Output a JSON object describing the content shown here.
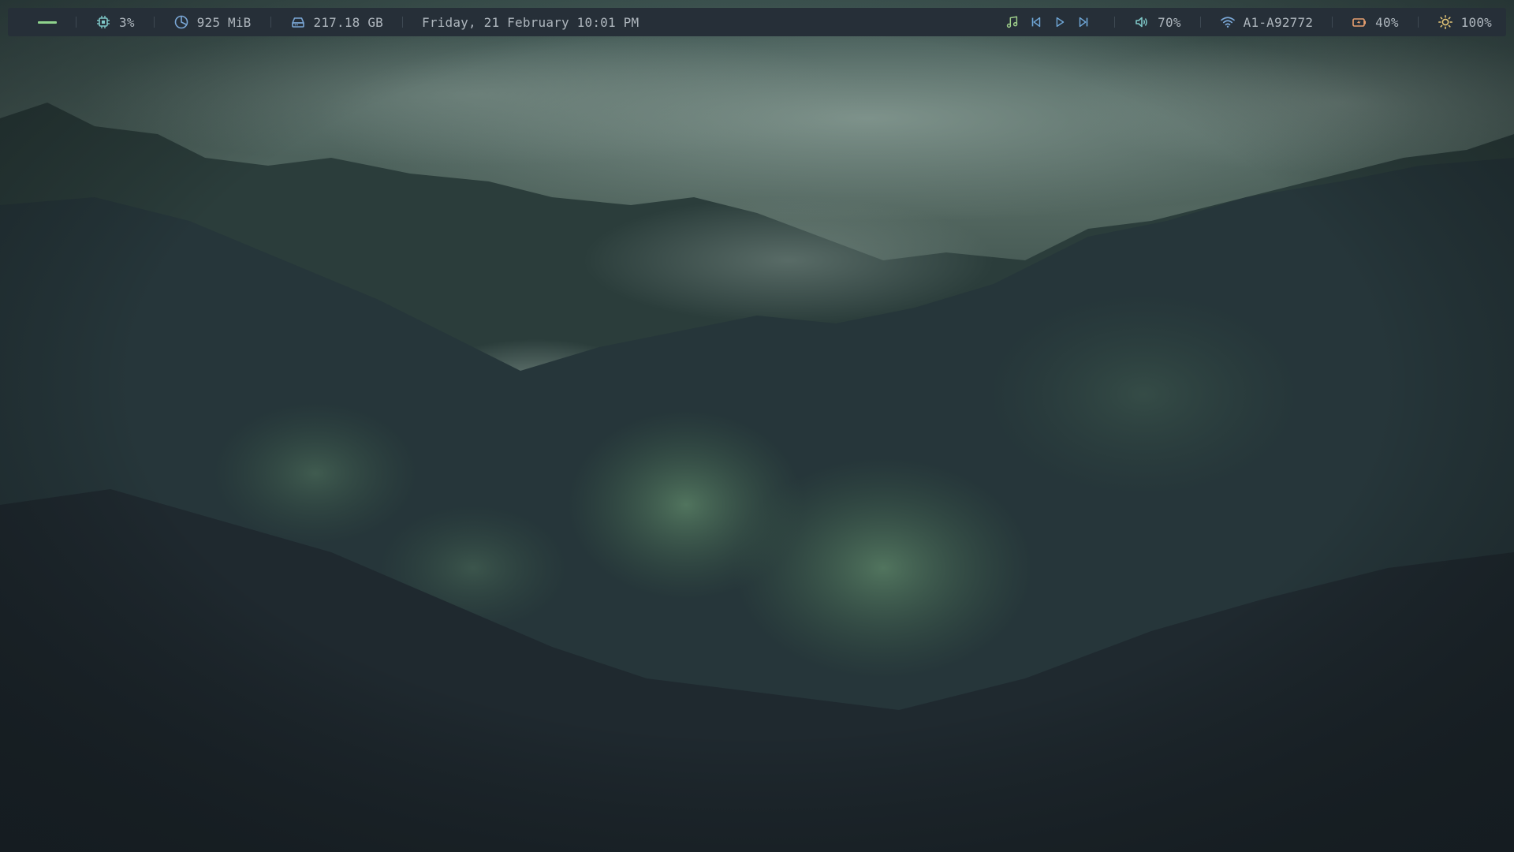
{
  "workspace": {
    "indicator_color": "#8fd38d"
  },
  "cpu": {
    "icon": "cpu-icon",
    "value": "3%",
    "icon_color": "#7fc8c8"
  },
  "memory": {
    "icon": "memory-pie-icon",
    "value": "925 MiB",
    "icon_color": "#7aa7d6"
  },
  "disk": {
    "icon": "disk-icon",
    "value": "217.18 GB",
    "icon_color": "#7aa7d6"
  },
  "clock": {
    "value": "Friday, 21 February 10:01 PM"
  },
  "media": {
    "note_icon": "music-note-icon",
    "prev_icon": "skip-previous-icon",
    "play_icon": "play-icon",
    "next_icon": "skip-next-icon",
    "note_color": "#9fd08b",
    "controls_color": "#6fa6d6"
  },
  "volume": {
    "icon": "speaker-icon",
    "value": "70%",
    "icon_color": "#7fc8c8"
  },
  "network": {
    "icon": "wifi-icon",
    "value": "A1-A92772",
    "icon_color": "#7aa7d6"
  },
  "battery": {
    "icon": "battery-charging-icon",
    "value": "40%",
    "icon_color": "#e8a070"
  },
  "brightness": {
    "icon": "sun-icon",
    "value": "100%",
    "icon_color": "#e7c878"
  },
  "colors": {
    "bar_bg": "#262f38",
    "text": "#aeb6bd"
  }
}
